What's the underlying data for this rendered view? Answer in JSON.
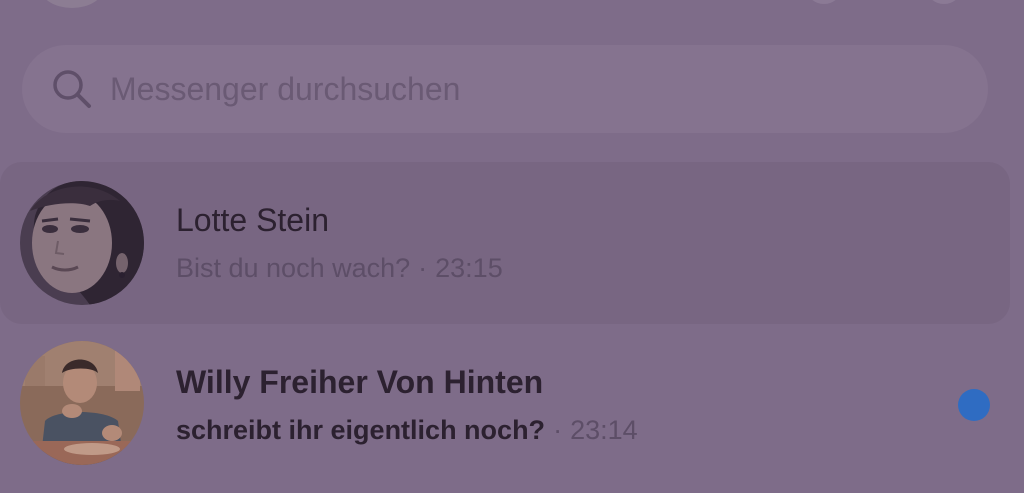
{
  "search": {
    "placeholder": "Messenger durchsuchen"
  },
  "chats": [
    {
      "name": "Lotte Stein",
      "message": "Bist du noch wach?",
      "separator": "·",
      "time": "23:15",
      "unread": false,
      "selected": true
    },
    {
      "name": "Willy Freiher Von Hinten",
      "message": "schreibt ihr eigentlich noch?",
      "separator": "·",
      "time": "23:14",
      "unread": true,
      "selected": false
    }
  ],
  "colors": {
    "background": "#7e6c89",
    "selected_row": "#786682",
    "unread_dot": "#2f6cc2"
  }
}
